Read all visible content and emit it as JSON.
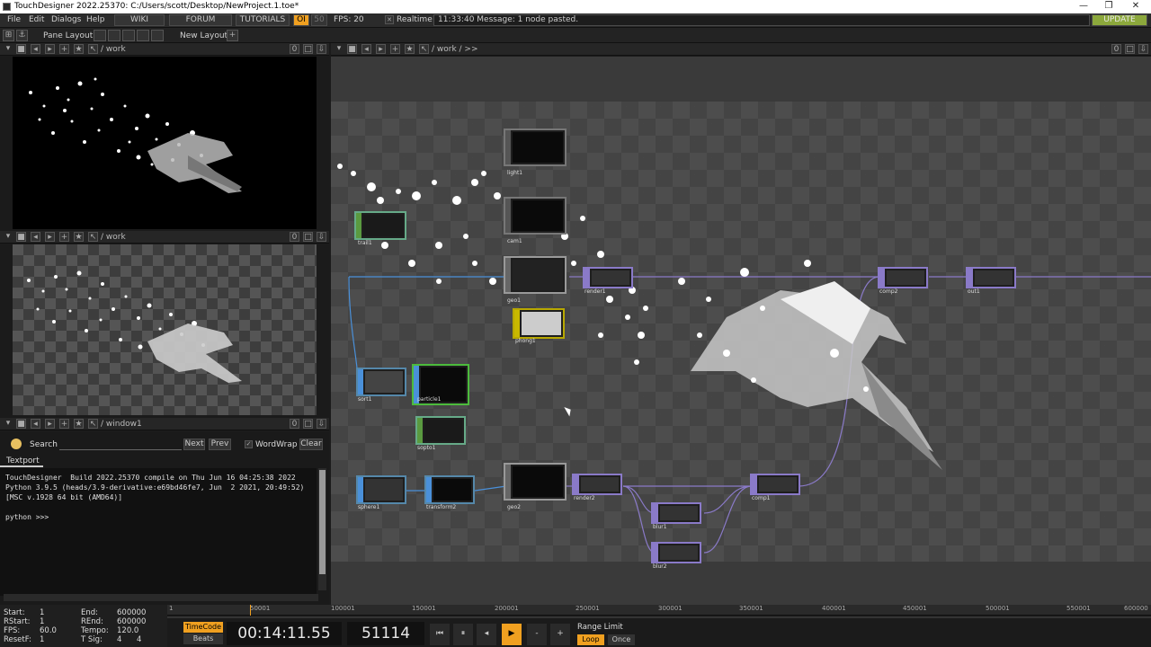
{
  "titlebar": {
    "title": "TouchDesigner 2022.25370: C:/Users/scott/Desktop/NewProject.1.toe*"
  },
  "menubar": {
    "items": [
      "File",
      "Edit",
      "Dialogs",
      "Help"
    ],
    "wiki": "WIKI",
    "forum": "FORUM",
    "tutorials": "TUTORIALS",
    "oi": "OI",
    "fps_small": "50",
    "fps": "FPS:  20",
    "realtime": "Realtime",
    "message": "11:33:40 Message: 1 node pasted.",
    "update": "UPDATE"
  },
  "toolbar2": {
    "pane_layout": "Pane Layout",
    "new_layout": "New Layout"
  },
  "panes": {
    "top_left_path": "/ work",
    "mid_left_path": "/ work",
    "bot_left_path": "/ window1",
    "network_path": "/ work / >>",
    "counter": "0"
  },
  "search": {
    "label": "Search",
    "next": "Next",
    "prev": "Prev",
    "wordwrap": "WordWrap",
    "clear": "Clear"
  },
  "textport": {
    "tab": "Textport",
    "lines": [
      "TouchDesigner  Build 2022.25370 compile on Thu Jun 16 04:25:38 2022",
      "Python 3.9.5 (heads/3.9-derivative:e69bd46fe7, Jun  2 2021, 20:49:52)",
      "[MSC v.1928 64 bit (AMD64)]",
      "",
      "python >>>"
    ]
  },
  "nodes": [
    {
      "label": "light1"
    },
    {
      "label": "cam1"
    },
    {
      "label": "geo1"
    },
    {
      "label": "phong1"
    },
    {
      "label": "trail1"
    },
    {
      "label": "sort1"
    },
    {
      "label": "particle1"
    },
    {
      "label": "sopto1"
    },
    {
      "label": "render1"
    },
    {
      "label": "comp2"
    },
    {
      "label": "out1"
    },
    {
      "label": "sphere1"
    },
    {
      "label": "transform2"
    },
    {
      "label": "geo2"
    },
    {
      "label": "render2"
    },
    {
      "label": "blur1"
    },
    {
      "label": "blur2"
    },
    {
      "label": "comp1"
    }
  ],
  "timeline": {
    "ticks": [
      "1",
      "50001",
      "100001",
      "150001",
      "200001",
      "250001",
      "300001",
      "350001",
      "400001",
      "450001",
      "500001",
      "550001",
      "600000"
    ]
  },
  "stats": {
    "start_label": "Start:",
    "start": "1",
    "end_label": "End:",
    "end": "600000",
    "rstart_label": "RStart:",
    "rstart": "1",
    "rend_label": "REnd:",
    "rend": "600000",
    "fps_label": "FPS:",
    "fps": "60.0",
    "tempo_label": "Tempo:",
    "tempo": "120.0",
    "resetf_label": "ResetF:",
    "resetf": "1",
    "tsig_label": "T Sig:",
    "tsig_a": "4",
    "tsig_b": "4"
  },
  "transport": {
    "timecode_btn": "TimeCode",
    "beats_btn": "Beats",
    "timecode": "00:14:11.55",
    "frame": "51114",
    "range_limit": "Range Limit",
    "loop": "Loop",
    "once": "Once"
  },
  "colors": {
    "accent_orange": "#f0a020",
    "update_green": "#8ca83c",
    "wire_blue": "#4a90d9",
    "wire_purple": "#8a7ac8"
  }
}
